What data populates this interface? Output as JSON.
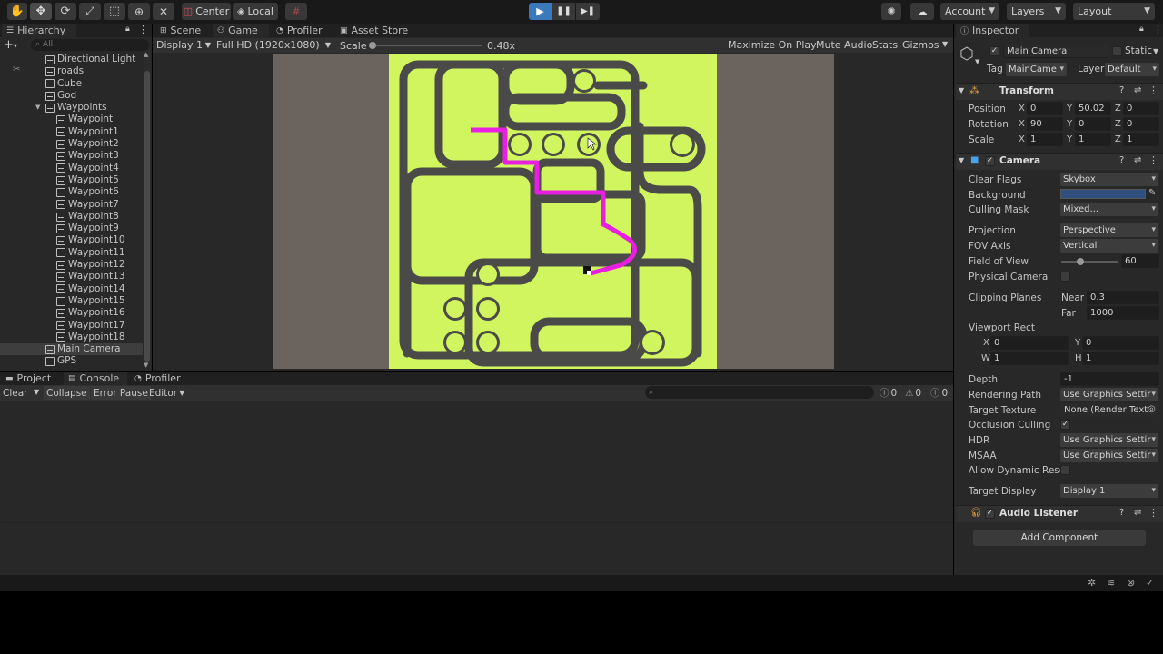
{
  "toolbar": {
    "pivot": "Center",
    "space": "Local",
    "account": "Account",
    "layers": "Layers",
    "layout": "Layout"
  },
  "hierarchy": {
    "tab": "Hierarchy",
    "search_placeholder": "All",
    "items": [
      {
        "label": "Directional Light",
        "indent": 1
      },
      {
        "label": "roads",
        "indent": 1
      },
      {
        "label": "Cube",
        "indent": 1
      },
      {
        "label": "God",
        "indent": 1
      },
      {
        "label": "Waypoints",
        "indent": 1
      },
      {
        "label": "Waypoint",
        "indent": 2
      },
      {
        "label": "Waypoint1",
        "indent": 2
      },
      {
        "label": "Waypoint2",
        "indent": 2
      },
      {
        "label": "Waypoint3",
        "indent": 2
      },
      {
        "label": "Waypoint4",
        "indent": 2
      },
      {
        "label": "Waypoint5",
        "indent": 2
      },
      {
        "label": "Waypoint6",
        "indent": 2
      },
      {
        "label": "Waypoint7",
        "indent": 2
      },
      {
        "label": "Waypoint8",
        "indent": 2
      },
      {
        "label": "Waypoint9",
        "indent": 2
      },
      {
        "label": "Waypoint10",
        "indent": 2
      },
      {
        "label": "Waypoint11",
        "indent": 2
      },
      {
        "label": "Waypoint12",
        "indent": 2
      },
      {
        "label": "Waypoint13",
        "indent": 2
      },
      {
        "label": "Waypoint14",
        "indent": 2
      },
      {
        "label": "Waypoint15",
        "indent": 2
      },
      {
        "label": "Waypoint16",
        "indent": 2
      },
      {
        "label": "Waypoint17",
        "indent": 2
      },
      {
        "label": "Waypoint18",
        "indent": 2
      },
      {
        "label": "Main Camera",
        "indent": 1
      },
      {
        "label": "GPS",
        "indent": 1
      }
    ]
  },
  "view_tabs": {
    "scene": "Scene",
    "game": "Game",
    "profiler": "Profiler",
    "asset_store": "Asset Store"
  },
  "game": {
    "display": "Display 1",
    "resolution": "Full HD (1920x1080)",
    "scale_label": "Scale",
    "scale_value": "0.48x",
    "maximize": "Maximize On Play",
    "mute": "Mute Audio",
    "stats": "Stats",
    "gizmos": "Gizmos"
  },
  "bottom": {
    "tab_project": "Project",
    "tab_console": "Console",
    "tab_profiler": "Profiler",
    "clear": "Clear",
    "collapse": "Collapse",
    "error_pause": "Error Pause",
    "editor": "Editor",
    "count_info": "0",
    "count_warn": "0",
    "count_err": "0"
  },
  "inspector": {
    "tab": "Inspector",
    "object_name": "Main Camera",
    "static": "Static",
    "tag_label": "Tag",
    "tag_value": "MainCame",
    "layer_label": "Layer",
    "layer_value": "Default",
    "transform": {
      "title": "Transform",
      "position_label": "Position",
      "pos": [
        "0",
        "50.02",
        "0"
      ],
      "rotation_label": "Rotation",
      "rot": [
        "90",
        "0",
        "0"
      ],
      "scale_label": "Scale",
      "scale": [
        "1",
        "1",
        "1"
      ]
    },
    "camera": {
      "title": "Camera",
      "clear_flags": "Clear Flags",
      "clear_flags_v": "Skybox",
      "background": "Background",
      "background_color": "#2f4f7f",
      "culling_mask": "Culling Mask",
      "culling_mask_v": "Mixed...",
      "projection": "Projection",
      "projection_v": "Perspective",
      "fov_axis": "FOV Axis",
      "fov_axis_v": "Vertical",
      "fov": "Field of View",
      "fov_v": "60",
      "physical": "Physical Camera",
      "clipping": "Clipping Planes",
      "near": "Near",
      "near_v": "0.3",
      "far": "Far",
      "far_v": "1000",
      "viewport": "Viewport Rect",
      "vx": "0",
      "vy": "0",
      "vw": "1",
      "vh": "1",
      "depth": "Depth",
      "depth_v": "-1",
      "rendering_path": "Rendering Path",
      "rendering_path_v": "Use Graphics Settir",
      "target_texture": "Target Texture",
      "target_texture_v": "None (Render Text",
      "occlusion": "Occlusion Culling",
      "hdr": "HDR",
      "hdr_v": "Use Graphics Settir",
      "msaa": "MSAA",
      "msaa_v": "Use Graphics Settir",
      "dynres": "Allow Dynamic Reso",
      "target_display": "Target Display",
      "target_display_v": "Display 1"
    },
    "audio_listener": "Audio Listener",
    "add_component": "Add Component"
  },
  "colors": {
    "accent": "#3a79bb",
    "map_green": "#d0f55f",
    "road": "#4a4a48",
    "path": "#e81ee0"
  }
}
